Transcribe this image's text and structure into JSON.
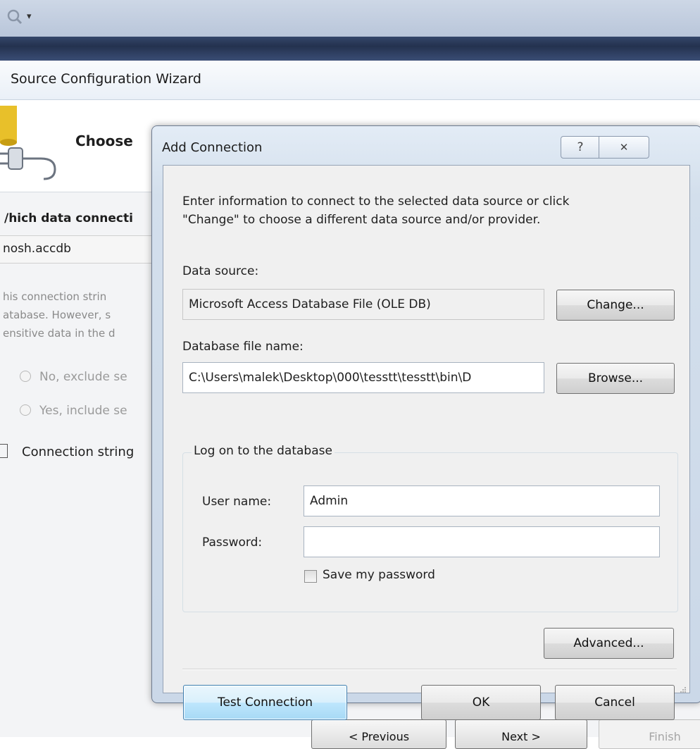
{
  "ide": {
    "toolbar_dropdown_glyph": "▾",
    "toolbar_icon": "find-icon"
  },
  "wizard": {
    "title": "Source Configuration Wizard",
    "heading": "Choose",
    "question": "/hich data connecti",
    "connection_value": "nosh.accdb",
    "description_lines": [
      "his connection strin",
      "atabase. However, s",
      "ensitive data in the d"
    ],
    "radio_exclude": "No, exclude se",
    "radio_include": "Yes, include se",
    "checkbox_label": "Connection string",
    "previous_label": "< Previous",
    "next_label": "Next >",
    "finish_label": "Finish"
  },
  "dialog": {
    "title": "Add Connection",
    "help_glyph": "?",
    "close_glyph": "✕",
    "intro_line1": "Enter information to connect to the selected data source or click",
    "intro_line2": "\"Change\" to choose a different data source and/or provider.",
    "data_source_label": "Data source:",
    "data_source_value": "Microsoft Access Database File (OLE DB)",
    "change_button": "Change...",
    "db_file_label": "Database file name:",
    "db_file_value": "C:\\Users\\malek\\Desktop\\000\\tesstt\\tesstt\\bin\\D",
    "browse_button": "Browse...",
    "logon_group_label": "Log on to the database",
    "username_label": "User name:",
    "username_value": "Admin",
    "password_label": "Password:",
    "password_value": "",
    "save_password_label": "Save my password",
    "save_password_checked": false,
    "advanced_button": "Advanced...",
    "test_connection_button": "Test Connection",
    "ok_button": "OK",
    "cancel_button": "Cancel"
  },
  "colors": {
    "dialog_frame": "#cbd8e8",
    "client_bg": "#f0f0f0",
    "focused_button": "#bee6fd",
    "ide_band": "#2a3a5a"
  }
}
